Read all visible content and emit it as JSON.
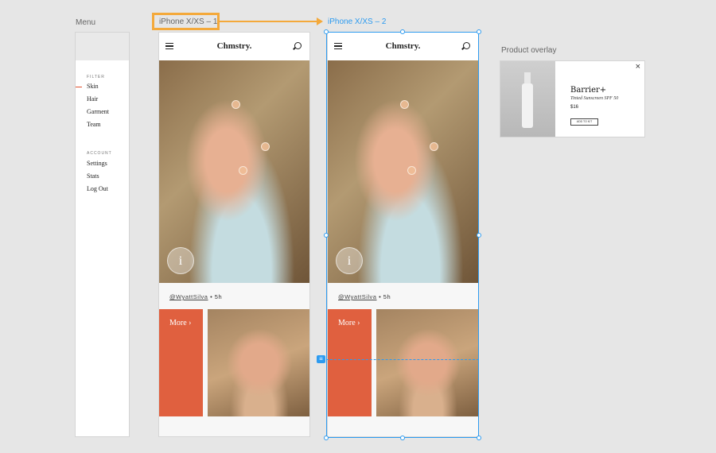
{
  "canvas": {
    "menu_label": "Menu",
    "artboard1_label": "iPhone X/XS – 1",
    "artboard2_label": "iPhone X/XS – 2",
    "overlay_label": "Product overlay",
    "accent": "#e0603f",
    "selection": "#2d9bf0",
    "highlight": "#f4a93b"
  },
  "menu": {
    "filter_title": "FILTER",
    "filter_items": [
      "Skin",
      "Hair",
      "Garment",
      "Team"
    ],
    "account_title": "ACCOUNT",
    "account_items": [
      "Settings",
      "Stats",
      "Log Out"
    ]
  },
  "app": {
    "logo": "Chmstry.",
    "author": "@WyattSilva",
    "time": "5h",
    "more": "More",
    "info": "i"
  },
  "overlay": {
    "title": "Barrier+",
    "subtitle": "Tinted Sunscreen SPF 50",
    "price": "$16",
    "button": "ADD TO KIT",
    "close": "×"
  }
}
